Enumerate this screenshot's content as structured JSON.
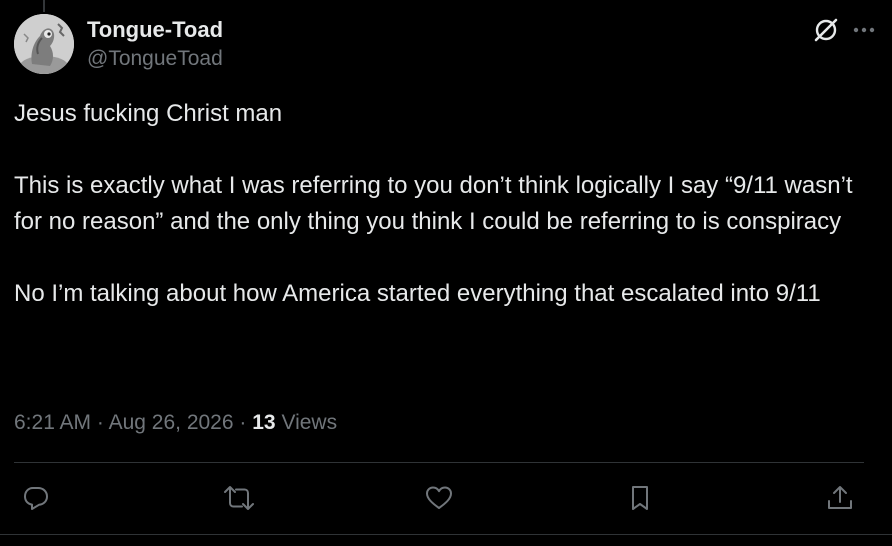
{
  "author": {
    "display_name": "Tongue-Toad",
    "handle": "@TongueToad",
    "avatar": "avatar-icon"
  },
  "header_icons": [
    "grok-icon",
    "more-icon"
  ],
  "tweet": {
    "paragraphs": [
      "Jesus fucking Christ man",
      "This is exactly what I was referring to you don’t think logically I say “9/11 wasn’t for no reason” and the only thing you think I could be referring to is conspiracy",
      "No I’m talking about how America started everything that escalated into 9/11"
    ]
  },
  "meta": {
    "time": "6:21 AM",
    "separator": "·",
    "date": "Aug 26, 2026",
    "views_count": "13",
    "views_label": "Views"
  },
  "actions": [
    "reply-icon",
    "retweet-icon",
    "like-icon",
    "bookmark-icon",
    "share-icon"
  ],
  "colors": {
    "background": "#000000",
    "text_primary": "#e7e9ea",
    "text_secondary": "#71767b",
    "divider": "#2f3336"
  }
}
